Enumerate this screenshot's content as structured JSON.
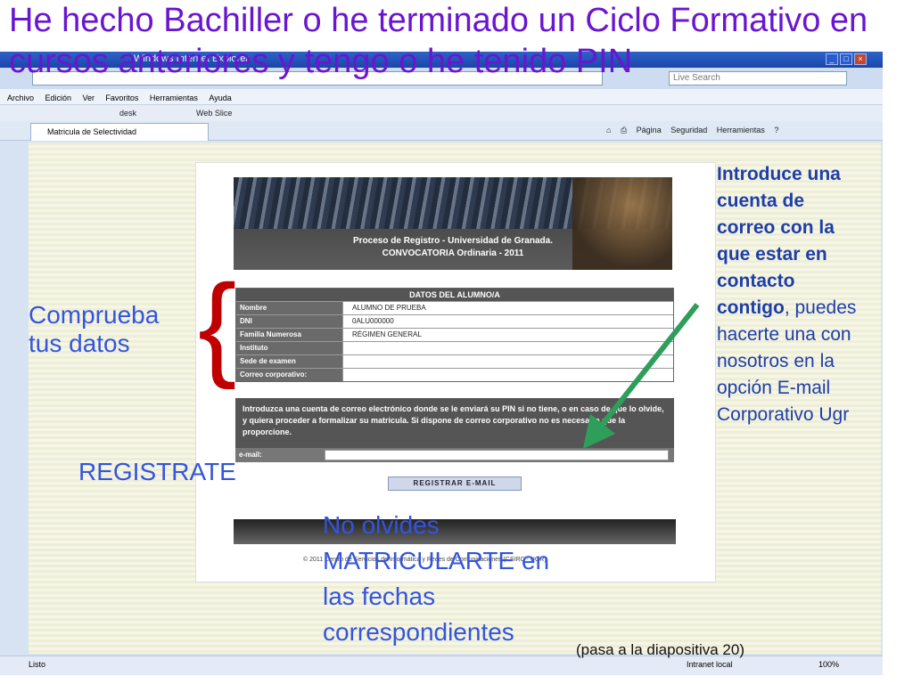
{
  "slide": {
    "title": "He hecho Bachiller o he terminado un Ciclo Formativo en cursos anteriores y tengo o he tenido PIN",
    "note_check": "Comprueba tus datos",
    "note_register": "REGISTRATE",
    "note_matricula": "No olvides MATRICULARTE en las fechas correspondientes",
    "note_email_bold": "Introduce una cuenta de correo con la que estar en contacto contigo",
    "note_email_rest": ", puedes hacerte una con nosotros en la opción E-mail Corporativo Ugr",
    "next_slide": "(pasa a la diapositiva 20)",
    "colors": {
      "title": "#6a16d0",
      "notes": "#3355dd",
      "brace": "#c00000",
      "arrow": "#2e9e5a"
    }
  },
  "browser": {
    "window_title": "Windows Internet Explorer",
    "search_placeholder": "Live Search",
    "menu": [
      "Archivo",
      "Edición",
      "Ver",
      "Favoritos",
      "Herramientas",
      "Ayuda"
    ],
    "favorites": [
      "desk",
      "Web Slice"
    ],
    "tab_title": "Matricula de Selectividad",
    "tools": [
      "Página",
      "Seguridad",
      "Herramientas"
    ],
    "status": "Listo",
    "zone": "Intranet local",
    "zoom": "100%"
  },
  "page": {
    "banner_line1": "Proceso de Registro - Universidad de Granada.",
    "banner_line2": "CONVOCATORIA Ordinaria - 2011",
    "table_title": "DATOS DEL ALUMNO/A",
    "rows": [
      {
        "label": "Nombre",
        "value": "ALUMNO DE PRUEBA"
      },
      {
        "label": "DNI",
        "value": "0ALU000000"
      },
      {
        "label": "Familia Numerosa",
        "value": "RÉGIMEN GENERAL"
      },
      {
        "label": "Instituto",
        "value": ""
      },
      {
        "label": "Sede de examen",
        "value": ""
      },
      {
        "label": "Correo corporativo:",
        "value": ""
      }
    ],
    "info_text": "Introduzca una cuenta de correo electrónico donde se le enviará su PIN si no tiene, o en caso de que lo olvide, y quiera proceder a formalizar su matricula. Si dispone de correo corporativo no es necesario que la proporcione.",
    "email_label": "e-mail:",
    "register_button": "REGISTRAR E-MAIL",
    "copyright": "© 2011 Centro de Servicios de Informática y Redes de Comunicaciones (CSIRC - UGR)"
  }
}
